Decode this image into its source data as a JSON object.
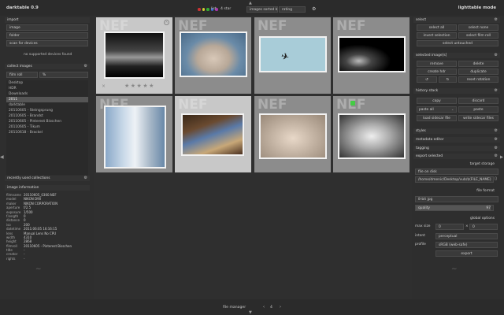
{
  "app": {
    "title": "darktable 0.9",
    "mode": "lighttable mode"
  },
  "topbar": {
    "list_label": "list",
    "filter_value": "4 star",
    "sort_label": "images sorted by",
    "sort_value": "rating",
    "color_dots": [
      "#cc3333",
      "#cccc33",
      "#33aa33",
      "#3366cc",
      "#aa33aa"
    ]
  },
  "left": {
    "import_header": "import",
    "import_buttons": [
      "image",
      "folder",
      "scan for devices"
    ],
    "no_devices": "no supported devices found",
    "collect_header": "collect images",
    "collect_mode": "film roll",
    "collect_query": "%",
    "collections": [
      "Desktop",
      "HDR",
      "Downloads",
      "2011",
      "darktable",
      "20110605 - Steingsprung",
      "20110605 - Brandst",
      "20110605 - Pinterest Bisschen",
      "20110605 - Tikum",
      "20110618 - Brackel"
    ],
    "collections_selected": 3,
    "recent_header": "recently used collections",
    "info_header": "image information",
    "info": [
      {
        "k": "filmname",
        "v": "20110605_0360.NEF"
      },
      {
        "k": "model",
        "v": "NIKON D90"
      },
      {
        "k": "maker",
        "v": "NIKON CORPORATION"
      },
      {
        "k": "aperture",
        "v": "f/2.5"
      },
      {
        "k": "exposure",
        "v": "1/500"
      },
      {
        "k": "f.length",
        "v": "0"
      },
      {
        "k": "distance",
        "v": "0"
      },
      {
        "k": "iso",
        "v": "200"
      },
      {
        "k": "datetime",
        "v": "2011:06:05 16:16:15"
      },
      {
        "k": "lens",
        "v": "Manual Lens No CPU"
      },
      {
        "k": "width",
        "v": "4310"
      },
      {
        "k": "height",
        "v": "2868"
      },
      {
        "k": "filmroll",
        "v": "20110605 - Pinterest Bisschen"
      },
      {
        "k": "title",
        "v": "-"
      },
      {
        "k": "creator",
        "v": "-"
      },
      {
        "k": "rights",
        "v": "-"
      }
    ]
  },
  "grid": {
    "badge": "NEF",
    "rating_stars": 5
  },
  "bottom": {
    "view_label": "file manager",
    "zoom_value": "4"
  },
  "right": {
    "select_header": "select",
    "select_buttons": [
      "select all",
      "select none",
      "invert selection",
      "select film roll",
      "select untouched"
    ],
    "selected_header": "selected image[s]",
    "selected_buttons": [
      "remove",
      "delete",
      "create hdr",
      "duplicate",
      "reset rotation"
    ],
    "history_header": "history stack",
    "history_buttons": [
      "copy",
      "discard",
      "paste all",
      "paste",
      "load sidecar file",
      "write sidecar files"
    ],
    "styles_header": "styles",
    "metadata_header": "metadata editor",
    "tagging_header": "tagging",
    "export_header": "export selected",
    "target_storage": "target storage",
    "storage_value": "file on disk",
    "path_value": "/home/dmenic/Desktop/vub/$(FILE_NAME)",
    "file_format": "file format",
    "format_value": "8-bit jpg",
    "quality_label": "quality",
    "quality_value": "97",
    "global_options": "global options",
    "max_size_label": "max size",
    "max_w": "0",
    "max_h": "0",
    "intent_label": "intent",
    "intent_value": "perceptual",
    "profile_label": "profile",
    "profile_value": "sRGB (web-safe)",
    "export_button": "export"
  }
}
